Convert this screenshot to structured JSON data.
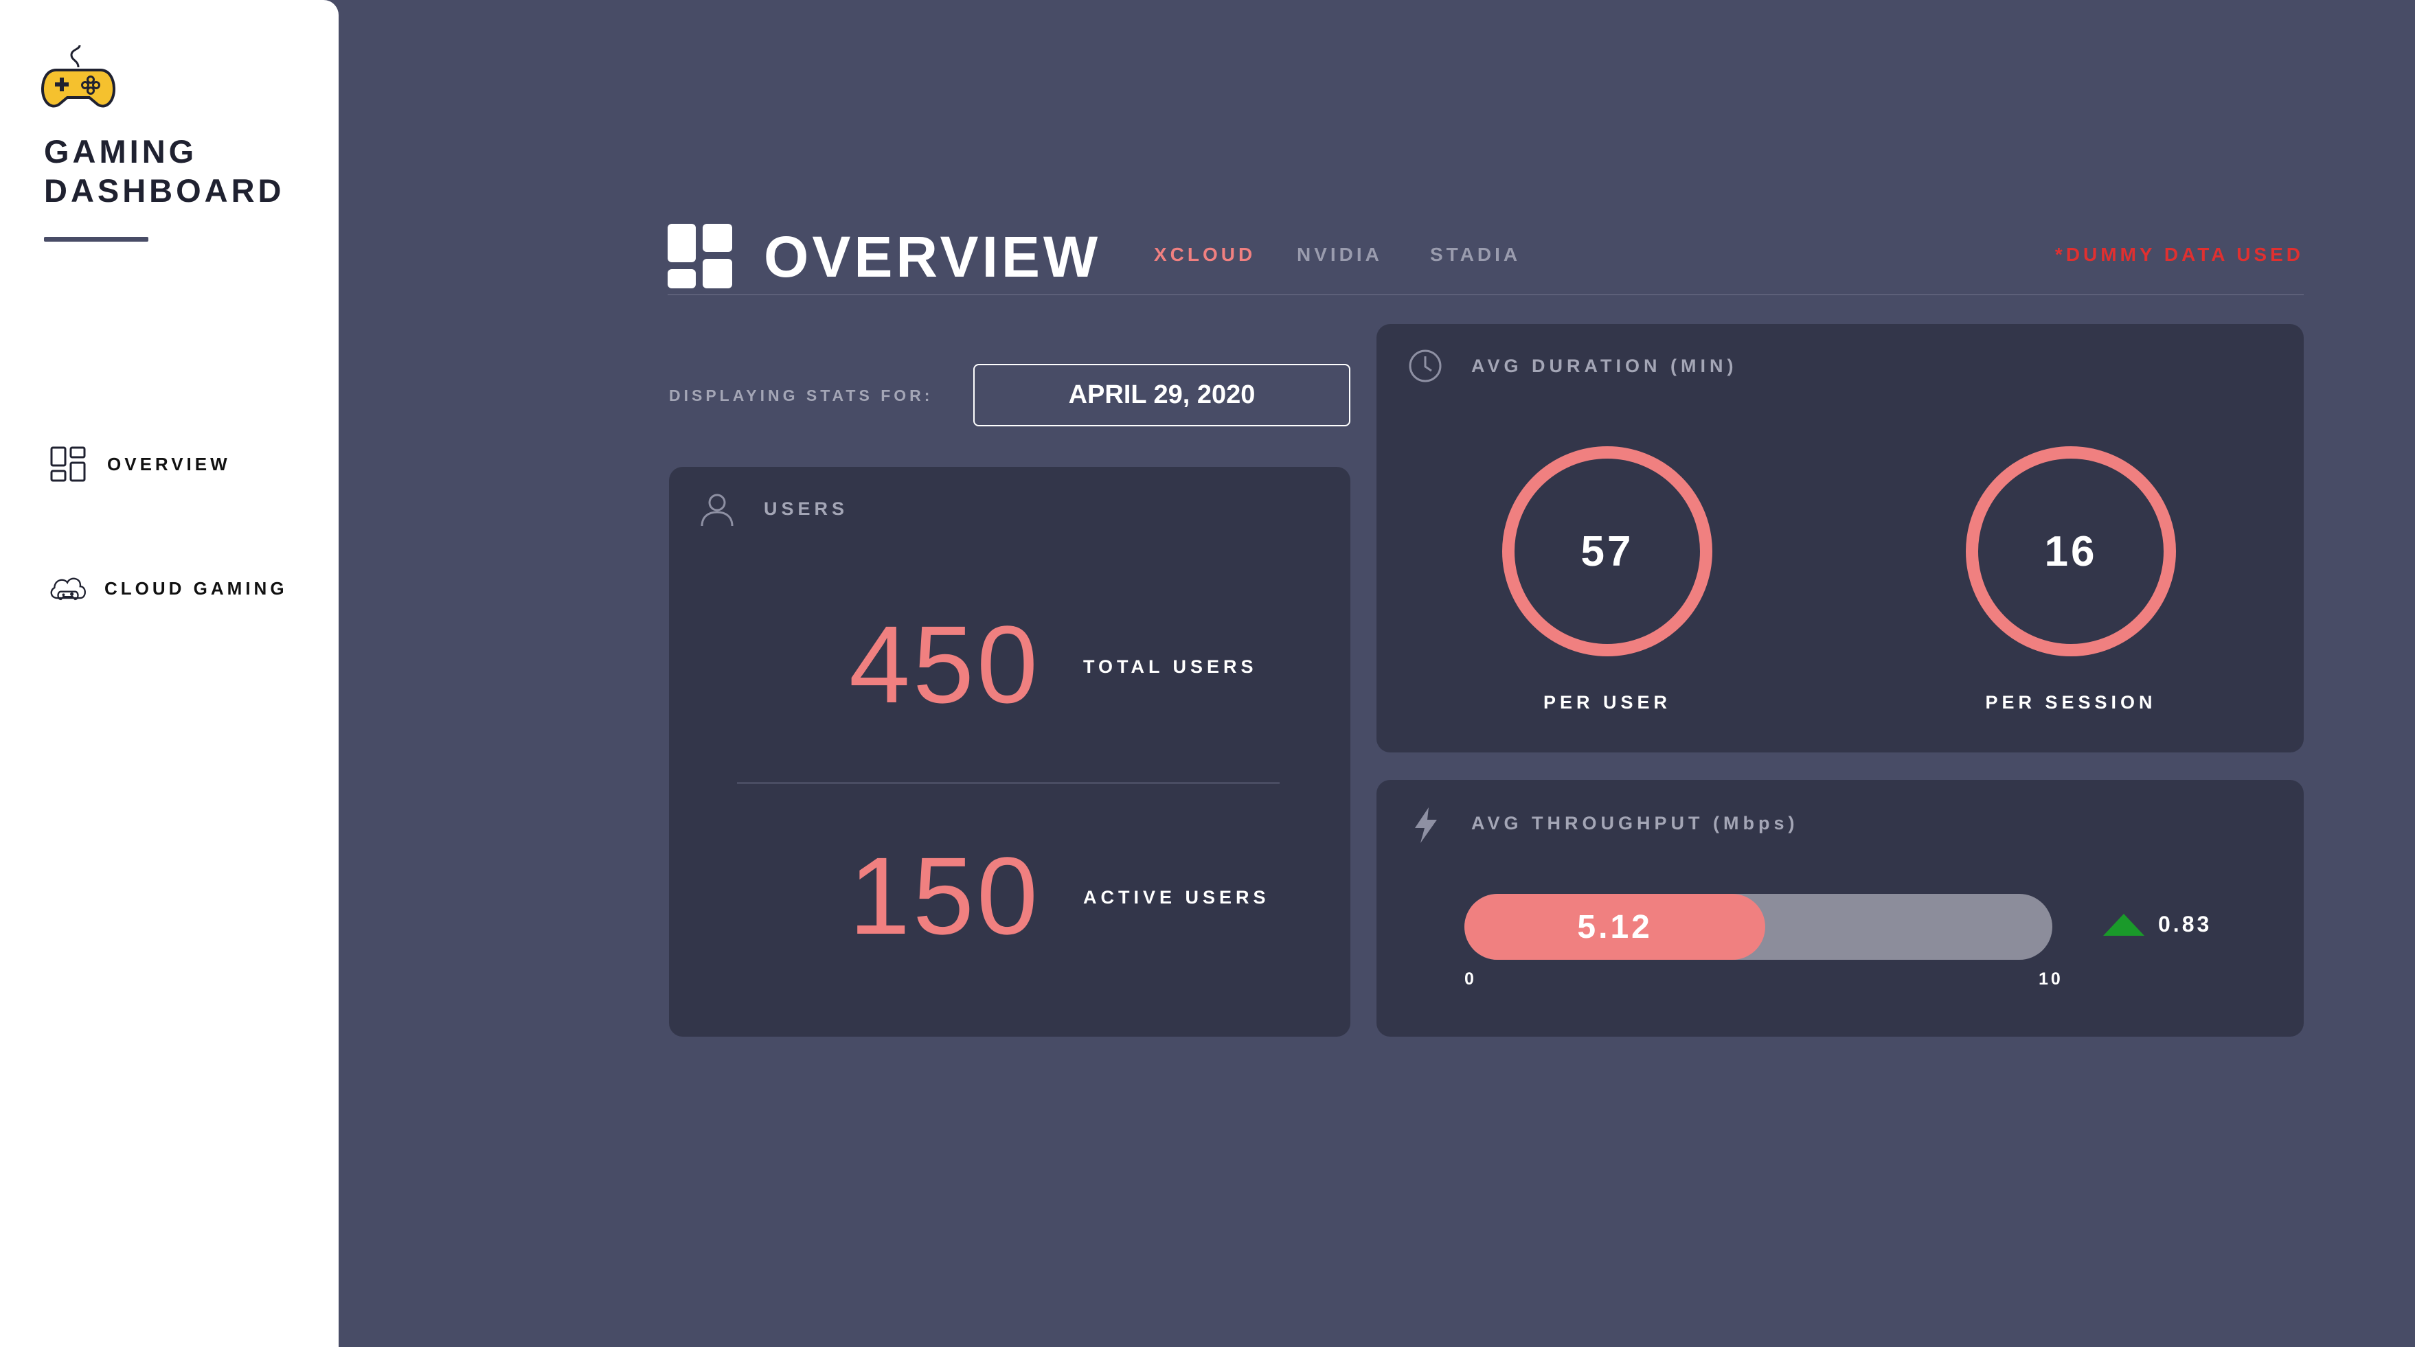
{
  "sidebar": {
    "brand_line1": "GAMING",
    "brand_line2": "DASHBOARD",
    "logo_icon": "gamepad-icon",
    "items": [
      {
        "label": "OVERVIEW",
        "icon": "grid-icon"
      },
      {
        "label": "CLOUD GAMING",
        "icon": "cloud-gamepad-icon"
      }
    ]
  },
  "header": {
    "title": "OVERVIEW",
    "tabs": [
      {
        "label": "XCLOUD",
        "active": true
      },
      {
        "label": "NVIDIA",
        "active": false
      },
      {
        "label": "STADIA",
        "active": false
      }
    ],
    "note": "*DUMMY DATA USED"
  },
  "date_selector": {
    "label": "DISPLAYING STATS FOR:",
    "value": "APRIL 29, 2020"
  },
  "users_card": {
    "title": "USERS",
    "total_value": "450",
    "total_label": "TOTAL USERS",
    "active_value": "150",
    "active_label": "ACTIVE USERS"
  },
  "duration_card": {
    "title": "AVG DURATION (MIN)",
    "per_user_value": "57",
    "per_user_label": "PER USER",
    "per_session_value": "16",
    "per_session_label": "PER SESSION"
  },
  "throughput_card": {
    "title": "AVG THROUGHPUT (Mbps)",
    "value": "5.12",
    "value_number": 5.12,
    "min": "0",
    "max": "10",
    "min_number": 0,
    "max_number": 10,
    "delta": "0.83",
    "delta_direction": "up"
  },
  "colors": {
    "background": "#484c66",
    "card": "#33364a",
    "accent": "#f08080",
    "note": "#e03030",
    "up": "#1a9a2a",
    "logo": "#f5c12e"
  }
}
